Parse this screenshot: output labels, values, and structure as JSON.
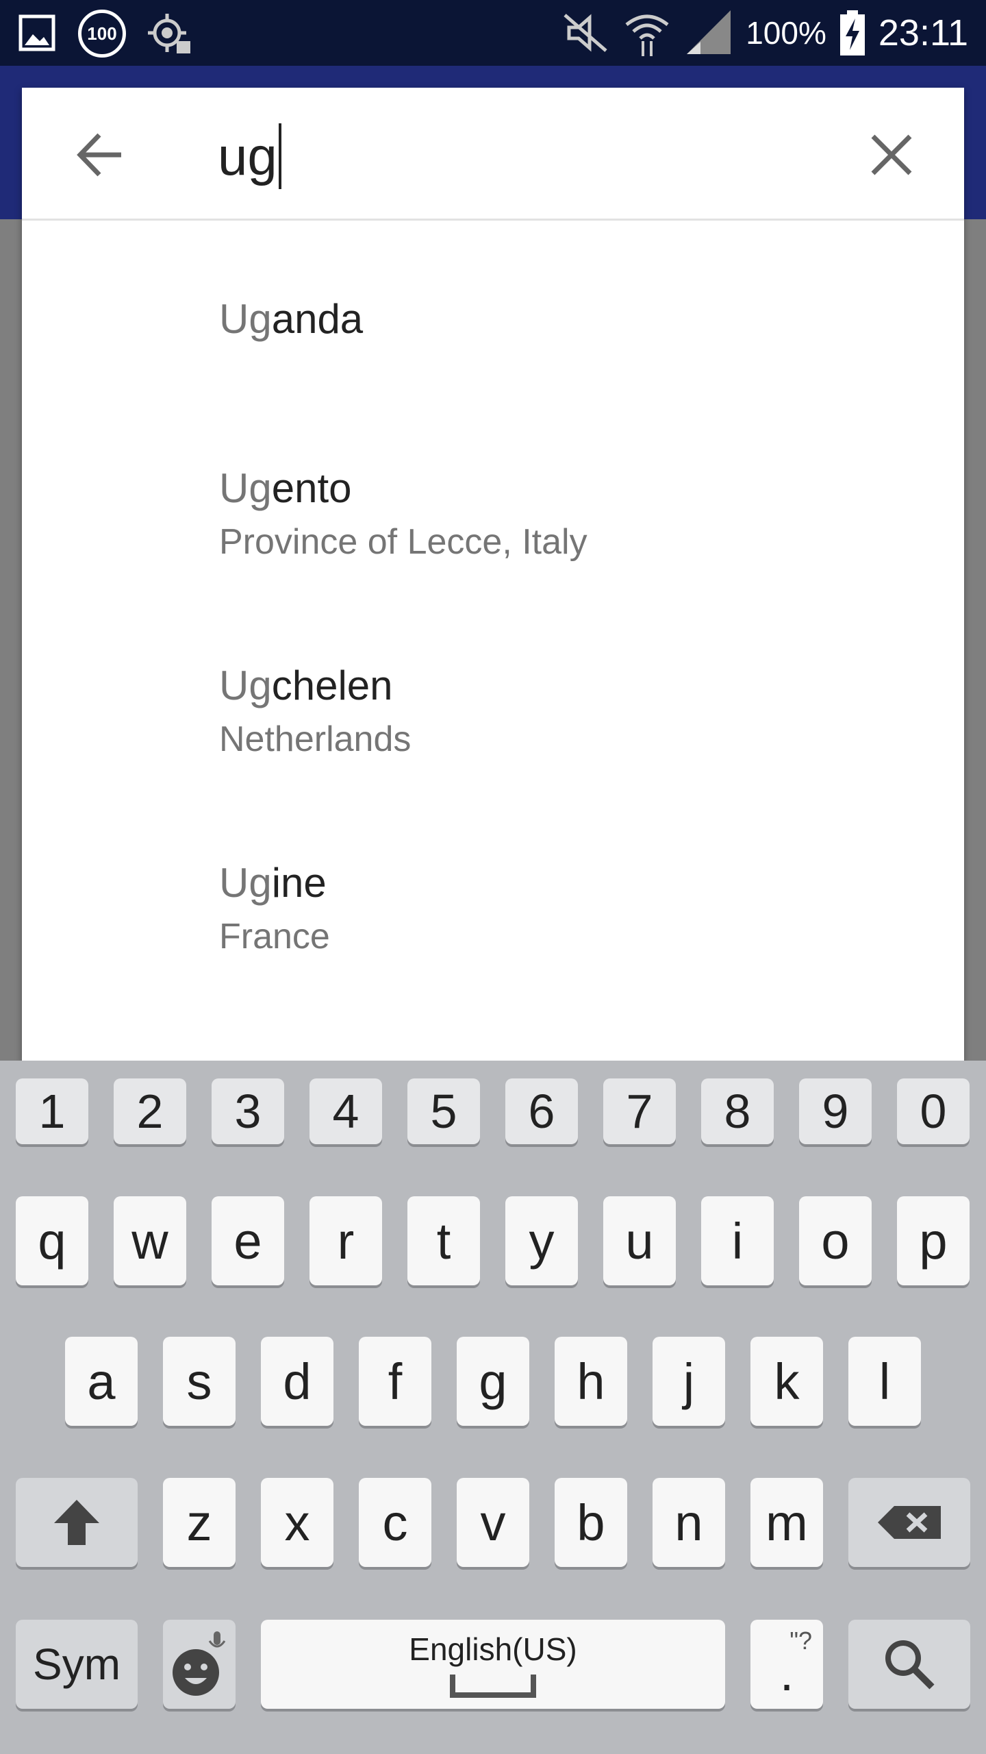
{
  "status_bar": {
    "time": "23:11",
    "battery": "100%",
    "badge": "100"
  },
  "search": {
    "query": "ug",
    "back_icon": "arrow-back-icon",
    "clear_icon": "close-icon"
  },
  "results": [
    {
      "match": "Ug",
      "rest": "anda",
      "subtitle": ""
    },
    {
      "match": "Ug",
      "rest": "ento",
      "subtitle": "Province of Lecce, Italy"
    },
    {
      "match": "Ug",
      "rest": "chelen",
      "subtitle": "Netherlands"
    },
    {
      "match": "Ug",
      "rest": "ine",
      "subtitle": "France"
    }
  ],
  "keyboard": {
    "numbers": [
      "1",
      "2",
      "3",
      "4",
      "5",
      "6",
      "7",
      "8",
      "9",
      "0"
    ],
    "row1": [
      "q",
      "w",
      "e",
      "r",
      "t",
      "y",
      "u",
      "i",
      "o",
      "p"
    ],
    "row2": [
      "a",
      "s",
      "d",
      "f",
      "g",
      "h",
      "j",
      "k",
      "l"
    ],
    "row3": [
      "z",
      "x",
      "c",
      "v",
      "b",
      "n",
      "m"
    ],
    "sym": "Sym",
    "space": "English(US)",
    "period": ".",
    "period_hint": "\"?",
    "shift_icon": "shift-arrow-icon",
    "backspace_icon": "backspace-icon",
    "emoji_icon": "emoji-mic-icon",
    "search_icon": "search-icon"
  }
}
